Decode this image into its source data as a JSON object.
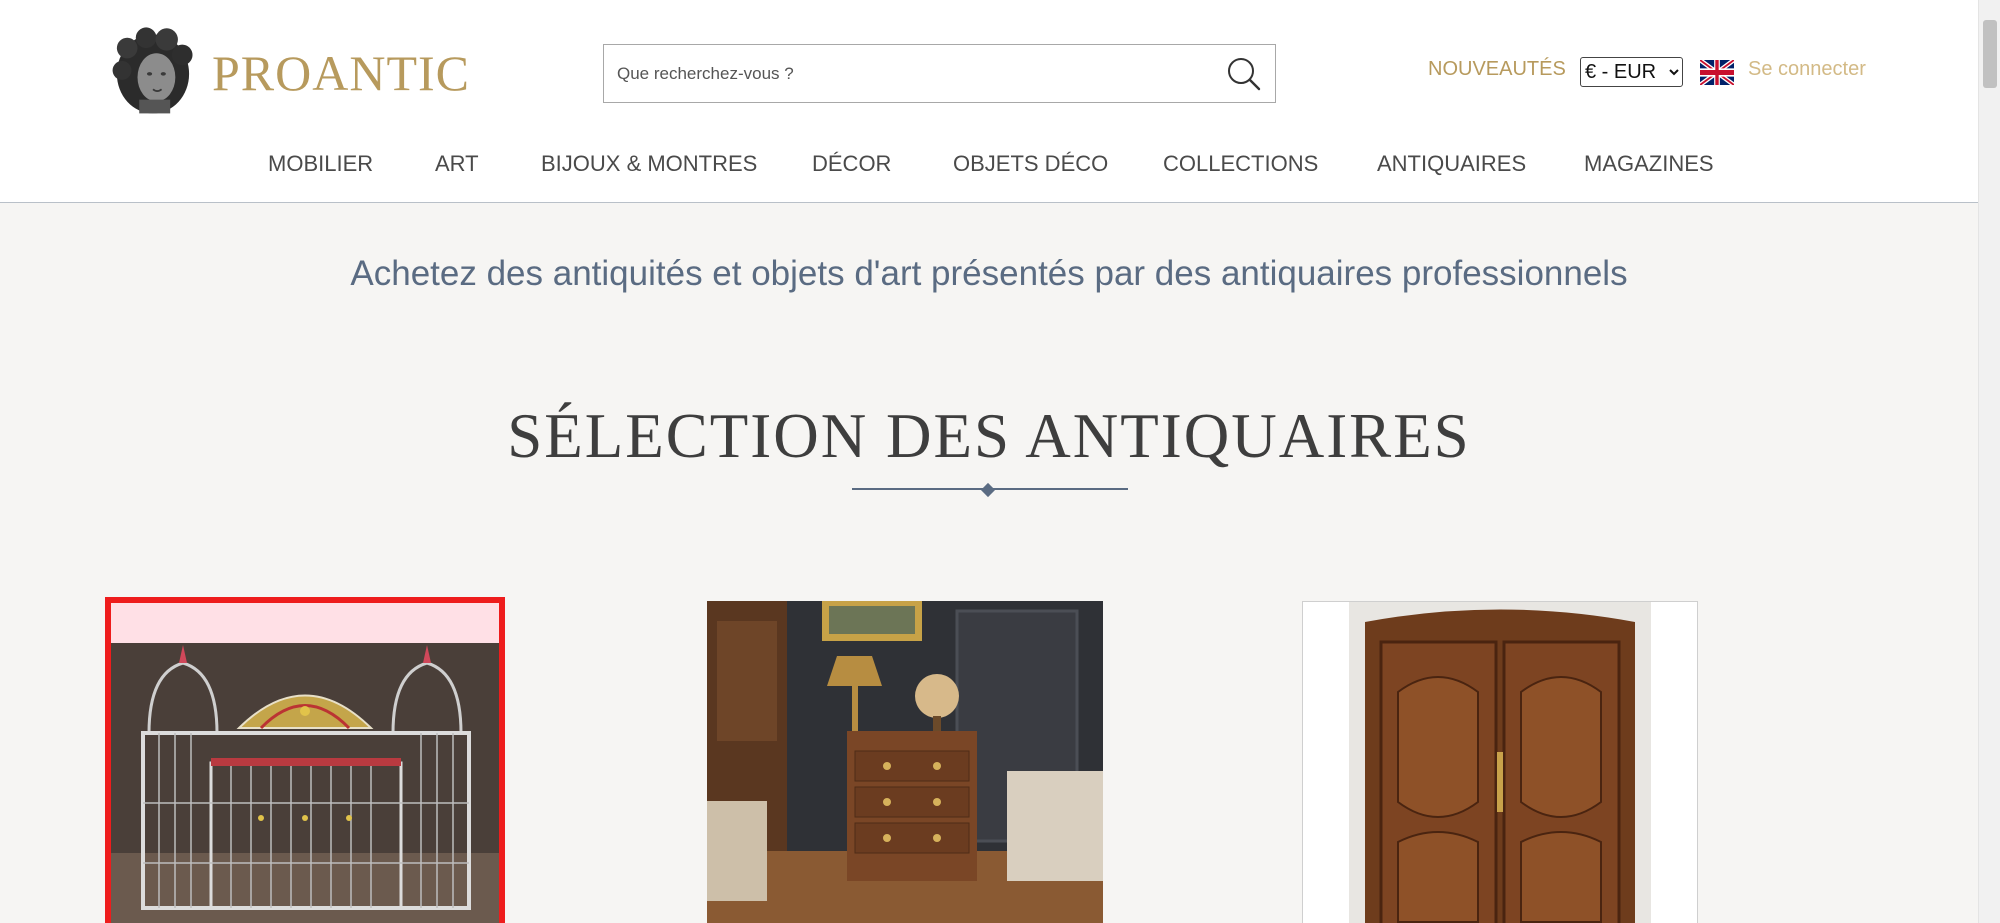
{
  "header": {
    "logo_text": "PROANTIC",
    "search_placeholder": "Que recherchez-vous ?",
    "new_label": "NOUVEAUTÉS",
    "currency_selected": "€ - EUR",
    "login_label": "Se connecter"
  },
  "nav": {
    "items": [
      "MOBILIER",
      "ART",
      "BIJOUX & MONTRES",
      "DÉCOR",
      "OBJETS DÉCO",
      "COLLECTIONS",
      "ANTIQUAIRES",
      "MAGAZINES"
    ]
  },
  "main": {
    "tagline": "Achetez des antiquités et objets d'art présentés par des antiquaires professionnels",
    "section_title": "SÉLECTION DES ANTIQUAIRES"
  },
  "cards": [
    {
      "subject": "birdcage-image"
    },
    {
      "subject": "furniture-interior-image"
    },
    {
      "subject": "armoire-image"
    }
  ],
  "colors": {
    "brand_gold": "#b79a5d",
    "login_gold": "#d3ba86",
    "tagline_blue": "#5a6b82",
    "selected_border": "#ee1c1c",
    "page_bg": "#f6f5f3"
  }
}
